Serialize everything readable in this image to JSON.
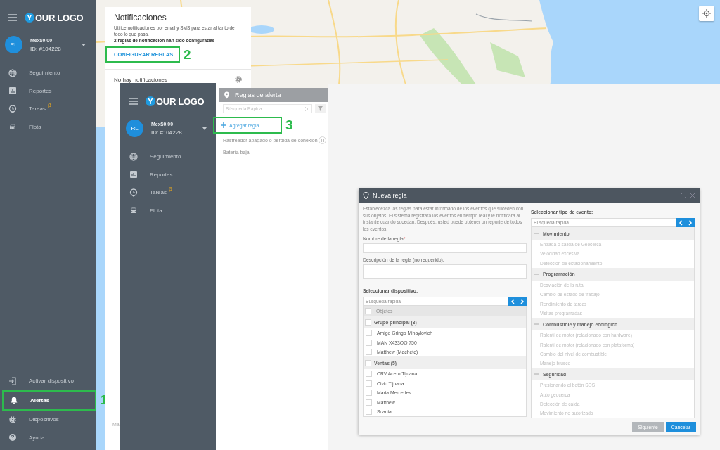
{
  "sidebar": {
    "logo": {
      "badge": "Y",
      "text": "OUR LOGO"
    },
    "account": {
      "initials": "RL",
      "balance": "Mex$0.00",
      "id": "ID: #104228"
    },
    "nav": [
      {
        "label": "Seguimiento",
        "kind": "globe",
        "selected": false
      },
      {
        "label": "Reportes",
        "kind": "chart",
        "selected": false
      },
      {
        "label": "Tareas",
        "kind": "clock",
        "badge": "β",
        "selected": false
      },
      {
        "label": "Flota",
        "kind": "car",
        "selected": false
      }
    ],
    "bottom_nav": [
      {
        "label": "Activar dispositivo",
        "kind": "login",
        "selected": false
      },
      {
        "label": "Alertas",
        "kind": "bell",
        "selected": true,
        "callout": "1"
      },
      {
        "label": "Dispositivos",
        "kind": "gear",
        "selected": false
      },
      {
        "label": "Ayuda",
        "kind": "help",
        "selected": false
      }
    ]
  },
  "notifications": {
    "title": "Notificaciones",
    "description": "Utilice notificaciones por email y SMS para estar al tanto de todo lo que pasa.",
    "summary": "2 reglas de notificación han sido configuradas",
    "action": {
      "label": "CONFIGURAR REGLAS",
      "callout": "2"
    },
    "empty": "No hay notificaciones",
    "footer": "Ma"
  },
  "second_sidebar": {
    "logo": {
      "badge": "Y",
      "text": "OUR LOGO"
    },
    "account": {
      "initials": "RL",
      "balance": "Mex$0.00",
      "id": "ID: #104228"
    },
    "nav": [
      {
        "label": "Seguimiento",
        "kind": "globe",
        "selected": false
      },
      {
        "label": "Reportes",
        "kind": "chart",
        "selected": false
      },
      {
        "label": "Tareas",
        "kind": "clock",
        "badge": "β",
        "selected": false
      },
      {
        "label": "Flota",
        "kind": "car",
        "selected": false
      }
    ]
  },
  "alert_rules": {
    "title": "Reglas de alerta",
    "search": {
      "placeholder": "Búsqueda Rápida"
    },
    "add": {
      "label": "Agregar regla",
      "callout": "3"
    },
    "rules": [
      {
        "label": "Rastreador apagado o pérdida de conexión",
        "paused": true
      },
      {
        "label": "Batería baja",
        "paused": false
      }
    ]
  },
  "dialog": {
    "title": "Nueva regla",
    "intro": "Establecezca las reglas para estar informado de los eventos que suceden con sus objetos. El sistema registrará los eventos en tiempo real y le notificará al instante cuando sucedan. Después, usted puede obtener un reporte de todos los eventos.",
    "name_label": "Nombre de la regla",
    "required_mark": "*",
    "name_suffix": ":",
    "description_label": "Descripción de la regla (no requerido):",
    "devices": {
      "label": "Seleccionar dispositivo:",
      "search": {
        "placeholder": "Búsqueda rápida"
      },
      "header": {
        "label": "Objetos",
        "checked": false
      },
      "groups": [
        {
          "name": "Grupo principal (3)",
          "checked": false,
          "items": [
            {
              "label": "Amigo Gringo Mihaylovich",
              "checked": false
            },
            {
              "label": "MAN X433OO 750",
              "checked": false
            },
            {
              "label": "Matthew (Machete)",
              "checked": false
            }
          ]
        },
        {
          "name": "Ventas (5)",
          "checked": false,
          "items": [
            {
              "label": "CRV Acero Tijuana",
              "checked": false
            },
            {
              "label": "Civic Tijuana",
              "checked": false
            },
            {
              "label": "Maria Mercedes",
              "checked": false
            },
            {
              "label": "Matthew",
              "checked": false
            },
            {
              "label": "Scania",
              "checked": false
            }
          ]
        }
      ]
    },
    "events": {
      "label": "Seleccionar tipo de evento:",
      "search": {
        "placeholder": "Búsqueda rápida"
      },
      "categories": [
        {
          "name": "Movimiento",
          "expanded": true,
          "items": [
            {
              "label": "Entrada o salida de Geocerca",
              "disabled": true
            },
            {
              "label": "Velocidad excesiva",
              "disabled": true
            },
            {
              "label": "Detección de estacionamiento",
              "disabled": true
            }
          ]
        },
        {
          "name": "Programación",
          "expanded": true,
          "items": [
            {
              "label": "Desviación de la ruta",
              "disabled": true
            },
            {
              "label": "Cambio de estado de trabajo",
              "disabled": true
            },
            {
              "label": "Rendimiento de tareas",
              "disabled": true
            },
            {
              "label": "Visitas programadas",
              "disabled": true
            }
          ]
        },
        {
          "name": "Combustible y manejo ecológico",
          "expanded": true,
          "items": [
            {
              "label": "Ralentí de motor (relacionado con hardware)",
              "disabled": true
            },
            {
              "label": "Ralentí de motor (relacionado con plataforma)",
              "disabled": true
            },
            {
              "label": "Cambio del nivel de combustible",
              "disabled": true
            },
            {
              "label": "Manejo brusco",
              "disabled": true
            }
          ]
        },
        {
          "name": "Seguridad",
          "expanded": true,
          "items": [
            {
              "label": "Presionando el botón SOS",
              "disabled": true
            },
            {
              "label": "Auto geocerca",
              "disabled": true
            },
            {
              "label": "Detección de caída",
              "disabled": true
            },
            {
              "label": "Movimiento no autorizado",
              "disabled": true
            }
          ]
        }
      ]
    },
    "buttons": [
      {
        "label": "Siguiente",
        "disabled": true
      },
      {
        "label": "Cancelar",
        "disabled": false
      }
    ]
  }
}
